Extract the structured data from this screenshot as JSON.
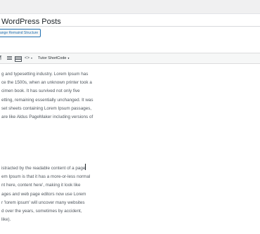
{
  "editor": {
    "title": "WordPress Posts",
    "chip_label": "ange Remaind Structure"
  },
  "toolbar": {
    "paragraph_icon": "¶",
    "code_icon": "<>",
    "dropdown_icon": "▾",
    "shortcode_label": "Tutor ShortCode",
    "shortcode_caret": "▾"
  },
  "content": {
    "paragraph1_lines": [
      "g and typesetting industry. Lorem Ipsum has",
      "ce the 1500s, when an unknown printer took a",
      "cimen book. It has survived not only five",
      "etting, remaining essentially unchanged. It was",
      "set sheets containing Lorem Ipsum passages,",
      "are like Aldus PageMaker including versions of"
    ],
    "paragraph2_lines": [
      "istracted by the readable content of a page",
      "em Ipsum is that it has a more-or-less normal",
      "nt here, content here', making it look like",
      "ages and web page editors now use Lorem",
      "r 'lorem ipsum' will uncover many websites",
      "d over the years, sometimes by accident,",
      " like)."
    ]
  }
}
